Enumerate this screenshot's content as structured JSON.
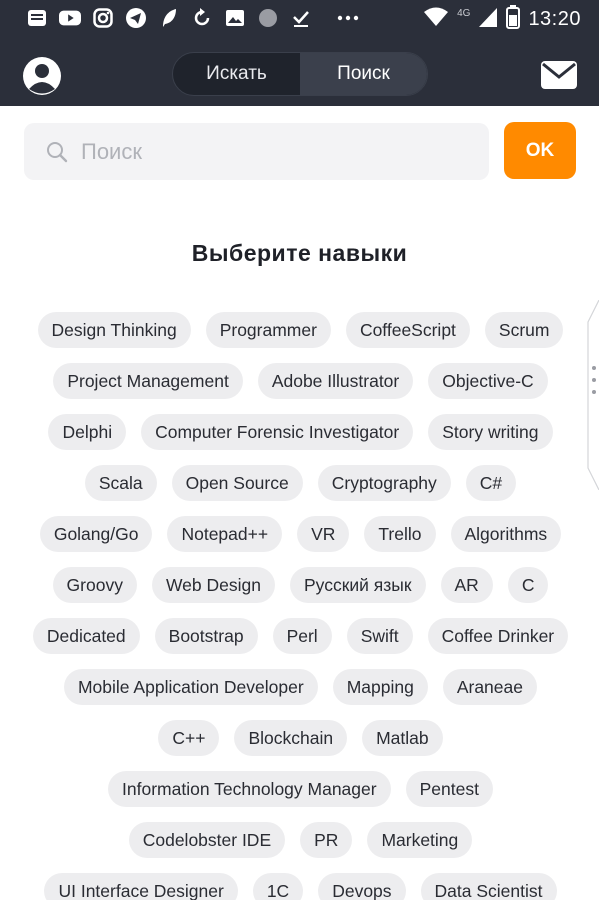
{
  "status_bar": {
    "time": "13:20",
    "network": "4G"
  },
  "header": {
    "tabs": [
      {
        "label": "Искать",
        "active": false
      },
      {
        "label": "Поиск",
        "active": true
      }
    ]
  },
  "search": {
    "placeholder": "Поиск",
    "value": "",
    "ok_label": "OK"
  },
  "title": "Выберите навыки",
  "skill_rows": [
    [
      "Design Thinking",
      "Programmer",
      "CoffeeScript",
      "Scrum"
    ],
    [
      "Project Management",
      "Adobe Illustrator",
      "Objective-C"
    ],
    [
      "Delphi",
      "Computer Forensic Investigator",
      "Story writing"
    ],
    [
      "Scala",
      "Open Source",
      "Cryptography",
      "C#"
    ],
    [
      "Golang/Go",
      "Notepad++",
      "VR",
      "Trello",
      "Algorithms"
    ],
    [
      "Groovy",
      "Web Design",
      "Русский язык",
      "AR",
      "C"
    ],
    [
      "Dedicated",
      "Bootstrap",
      "Perl",
      "Swift",
      "Coffee Drinker"
    ],
    [
      "Mobile Application Developer",
      "Mapping",
      "Araneae"
    ],
    [
      "C++",
      "Blockchain",
      "Matlab"
    ],
    [
      "Information Technology Manager",
      "Pentest"
    ],
    [
      "Codelobster IDE",
      "PR",
      "Marketing"
    ],
    [
      "UI Interface Designer",
      "1C",
      "Devops",
      "Data Scientist"
    ]
  ],
  "colors": {
    "header_bg": "#2b2f3a",
    "accent": "#ff8a00",
    "chip_bg": "#ededef"
  }
}
